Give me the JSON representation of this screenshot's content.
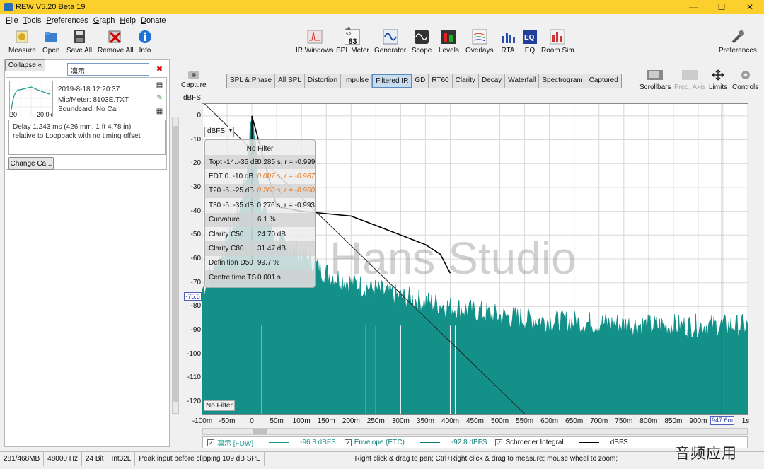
{
  "window": {
    "title": "REW V5.20 Beta 19"
  },
  "menu": [
    "File",
    "Tools",
    "Preferences",
    "Graph",
    "Help",
    "Donate"
  ],
  "toolbar_left": [
    {
      "label": "Measure",
      "icon": "microphone-icon"
    },
    {
      "label": "Open",
      "icon": "folder-icon"
    },
    {
      "label": "Save All",
      "icon": "floppy-icon"
    },
    {
      "label": "Remove All",
      "icon": "remove-all-icon"
    },
    {
      "label": "Info",
      "icon": "info-icon"
    }
  ],
  "toolbar_center": [
    {
      "label": "IR Windows",
      "icon": "ir-windows-icon"
    },
    {
      "label": "SPL Meter",
      "icon": "spl-meter-icon",
      "badge_top": "dB SPL",
      "badge": "83"
    },
    {
      "label": "Generator",
      "icon": "generator-icon"
    },
    {
      "label": "Scope",
      "icon": "scope-icon"
    },
    {
      "label": "Levels",
      "icon": "levels-icon"
    },
    {
      "label": "Overlays",
      "icon": "overlays-icon"
    },
    {
      "label": "RTA",
      "icon": "rta-icon"
    },
    {
      "label": "EQ",
      "icon": "eq-icon"
    },
    {
      "label": "Room Sim",
      "icon": "room-sim-icon"
    }
  ],
  "toolbar_right": {
    "label": "Preferences",
    "icon": "wrench-icon"
  },
  "left_panel": {
    "collapse_label": "Collapse",
    "measurement_name": "凛示",
    "date": "2019-8-18 12:20:37",
    "mic": "Mic/Meter: 8103E.TXT",
    "soundcard": "Soundcard: No Cal",
    "thumb_x_min": "20",
    "thumb_x_max": "20.0k",
    "notes_line1": "Delay 1.243 ms (426 mm, 1 ft 4.78 in)",
    "notes_line2": "relative to Loopback with no timing offset",
    "change_cal_label": "Change Ca..."
  },
  "capture_label": "Capture",
  "graph_tabs": [
    "SPL & Phase",
    "All SPL",
    "Distortion",
    "Impulse",
    "Filtered IR",
    "GD",
    "RT60",
    "Clarity",
    "Decay",
    "Waterfall",
    "Spectrogram",
    "Captured"
  ],
  "active_tab": "Filtered IR",
  "graph_tools": [
    {
      "label": "Scrollbars",
      "icon": "scrollbars-icon",
      "enabled": true
    },
    {
      "label": "Freq. Axis",
      "icon": "freq-axis-icon",
      "enabled": false
    },
    {
      "label": "Limits",
      "icon": "limits-icon",
      "enabled": true
    },
    {
      "label": "Controls",
      "icon": "controls-icon",
      "enabled": true
    }
  ],
  "plot": {
    "y_unit": "dBFS",
    "y_ticks": [
      "0",
      "-10",
      "-20",
      "-30",
      "-40",
      "-50",
      "-60",
      "-70",
      "-80",
      "-90",
      "-100",
      "-110",
      "-120"
    ],
    "x_ticks": [
      "-100m",
      "-50m",
      "0",
      "50m",
      "100m",
      "150m",
      "200m",
      "250m",
      "300m",
      "350m",
      "400m",
      "450m",
      "500m",
      "550m",
      "600m",
      "650m",
      "700m",
      "750m",
      "800m",
      "850m",
      "900m",
      "1s"
    ],
    "unit_selector": "dBFS",
    "filter_tag": "No Filter",
    "cursor_y": "-75.6",
    "cursor_x": "947.6m",
    "watermark_text": "Hans Studio"
  },
  "overlay": {
    "title": "No Filter",
    "rows": [
      {
        "k": "Topt -14..-35 dB",
        "v": "0.285 s,  r = -0.999",
        "style": "normal"
      },
      {
        "k": "EDT  0..-10 dB",
        "v": "0.007 s,  r = -0.987",
        "style": "orange"
      },
      {
        "k": "T20 -5..-25 dB",
        "v": "0.260 s,  r = -0.960",
        "style": "orange"
      },
      {
        "k": "T30 -5..-35 dB",
        "v": "0.276 s,  r = -0.993",
        "style": "normal"
      },
      {
        "k": "Curvature",
        "v": "6.1 %",
        "style": "normal"
      },
      {
        "k": "Clarity C50",
        "v": "24.70 dB",
        "style": "normal"
      },
      {
        "k": "Clarity C80",
        "v": "31.47 dB",
        "style": "normal"
      },
      {
        "k": "Definition D50",
        "v": "99.7 %",
        "style": "normal"
      },
      {
        "k": "Centre time TS",
        "v": "0.001 s",
        "style": "normal"
      }
    ]
  },
  "legend": [
    {
      "label": "凛示 [FDW]",
      "value": "-96.8 dBFS",
      "color": "#1b9a8f"
    },
    {
      "label": "Envelope (ETC)",
      "value": "-92.8 dBFS",
      "color": "#0e7a78"
    },
    {
      "label": "Schroeder Integral",
      "value": "dBFS",
      "color": "#000000"
    }
  ],
  "status": [
    "281/468MB",
    "48000 Hz",
    "24 Bit",
    "Int32L",
    "Peak input before clipping 109 dB SPL",
    "Right click & drag to pan; Ctrl+Right click & drag to measure; mouse wheel to zoom;"
  ],
  "corner_watermark": "音频应用",
  "colors": {
    "titlebar": "#fbd02c",
    "ir_fill": "#139088",
    "accent": "#3040b0"
  },
  "chart_data": {
    "type": "line",
    "xlabel": "",
    "ylabel": "dBFS",
    "xlim": [
      -0.1,
      1.0
    ],
    "ylim": [
      -125,
      5
    ],
    "grid": true,
    "series": [
      {
        "name": "凛示 [FDW]",
        "points": [
          [
            -0.1,
            -75
          ],
          [
            -0.06,
            -60
          ],
          [
            -0.03,
            -45
          ],
          [
            -0.01,
            -25
          ],
          [
            0.0,
            0
          ],
          [
            0.02,
            -40
          ],
          [
            0.05,
            -55
          ],
          [
            0.1,
            -60
          ],
          [
            0.15,
            -68
          ],
          [
            0.2,
            -72
          ],
          [
            0.3,
            -78
          ],
          [
            0.4,
            -82
          ],
          [
            0.5,
            -86
          ],
          [
            0.6,
            -88
          ],
          [
            0.7,
            -89
          ],
          [
            0.8,
            -90
          ],
          [
            0.9,
            -90
          ],
          [
            1.0,
            -90
          ]
        ]
      },
      {
        "name": "Schroeder Integral",
        "points": [
          [
            0.0,
            0
          ],
          [
            0.05,
            -38
          ],
          [
            0.1,
            -40
          ],
          [
            0.15,
            -41
          ],
          [
            0.2,
            -42
          ],
          [
            0.25,
            -46
          ],
          [
            0.3,
            -50
          ],
          [
            0.35,
            -54
          ],
          [
            0.38,
            -58
          ],
          [
            0.4,
            -66
          ]
        ]
      },
      {
        "points": [
          [
            -0.1,
            6
          ],
          [
            0.55,
            -125
          ]
        ]
      }
    ]
  }
}
